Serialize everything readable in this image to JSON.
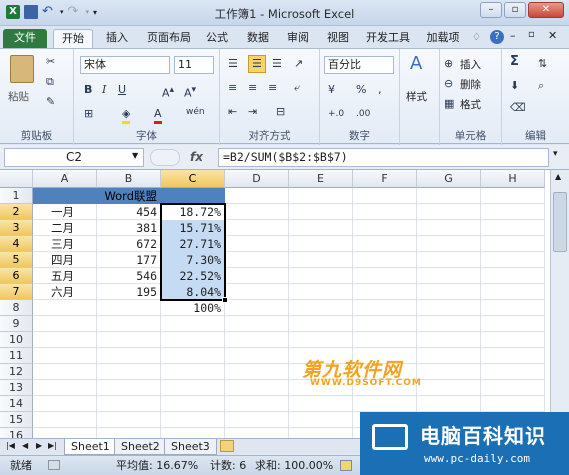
{
  "window": {
    "title": "工作簿1 - Microsoft Excel"
  },
  "tabs": [
    "文件",
    "开始",
    "插入",
    "页面布局",
    "公式",
    "数据",
    "审阅",
    "视图",
    "开发工具",
    "加载项"
  ],
  "ribbon": {
    "clipboard": {
      "paste": "粘贴",
      "name": "剪贴板"
    },
    "font": {
      "family": "宋体",
      "size": "11",
      "name": "字体",
      "phonetic": "wén"
    },
    "alignment": {
      "name": "对齐方式"
    },
    "number": {
      "format": "百分比",
      "name": "数字"
    },
    "styles": {
      "label": "样式"
    },
    "cells": {
      "insert": "插入",
      "delete": "删除",
      "format": "格式",
      "name": "单元格"
    },
    "editing": {
      "name": "编辑",
      "sum": "Σ"
    }
  },
  "formula_bar": {
    "name_box": "C2",
    "fx": "fx",
    "formula": "=B2/SUM($B$2:$B$7)"
  },
  "columns": [
    "A",
    "B",
    "C",
    "D",
    "E",
    "F",
    "G",
    "H"
  ],
  "rows": [
    "1",
    "2",
    "3",
    "4",
    "5",
    "6",
    "7",
    "8",
    "9",
    "10",
    "11",
    "12",
    "13",
    "14",
    "15",
    "16"
  ],
  "sheet": {
    "header_b1": "Word联盟",
    "data": [
      {
        "month": "一月",
        "value": "454",
        "pct": "18.72%"
      },
      {
        "month": "二月",
        "value": "381",
        "pct": "15.71%"
      },
      {
        "month": "三月",
        "value": "672",
        "pct": "27.71%"
      },
      {
        "month": "四月",
        "value": "177",
        "pct": "7.30%"
      },
      {
        "month": "五月",
        "value": "546",
        "pct": "22.52%"
      },
      {
        "month": "六月",
        "value": "195",
        "pct": "8.04%"
      }
    ],
    "total_c8": "100%"
  },
  "sheet_tabs": [
    "Sheet1",
    "Sheet2",
    "Sheet3"
  ],
  "status": {
    "mode": "就绪",
    "average": "平均值: 16.67%",
    "count": "计数: 6",
    "sum": "求和: 100.00%"
  },
  "watermark": {
    "brand": "第九软件网",
    "url": "WWW.D9SOFT.COM",
    "site": "电脑百科知识",
    "site_url": "www.pc-daily.com"
  },
  "colors": {
    "file_tab": "#2f7a3d",
    "header_fill": "#4e81bd",
    "selection": "#c5daf3",
    "header_highlight": "#f1c75d"
  }
}
